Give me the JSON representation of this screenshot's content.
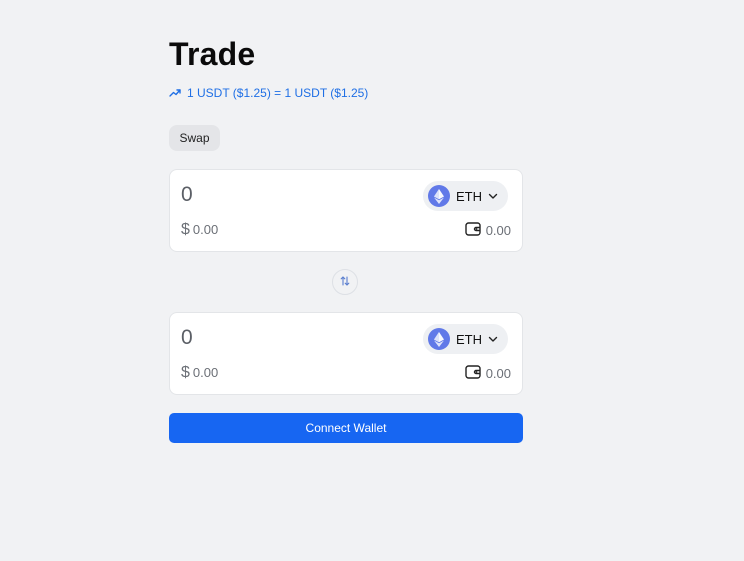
{
  "page": {
    "title": "Trade"
  },
  "rate": {
    "icon": "trending-up-icon",
    "text": "1 USDT ($1.25) = 1 USDT ($1.25)",
    "color": "#1f6fe5"
  },
  "tabs": {
    "swap_label": "Swap"
  },
  "from_card": {
    "amount_placeholder": "0",
    "token_icon": "ethereum-icon",
    "token_symbol": "ETH",
    "usd_symbol": "$",
    "usd_value": "0.00",
    "balance_icon": "wallet-icon",
    "balance": "0.00"
  },
  "switch": {
    "icon": "swap-direction-icon"
  },
  "to_card": {
    "amount_placeholder": "0",
    "token_icon": "ethereum-icon",
    "token_symbol": "ETH",
    "usd_symbol": "$",
    "usd_value": "0.00",
    "balance_icon": "wallet-icon",
    "balance": "0.00"
  },
  "actions": {
    "connect_wallet_label": "Connect Wallet",
    "accent_color": "#1766f2"
  }
}
